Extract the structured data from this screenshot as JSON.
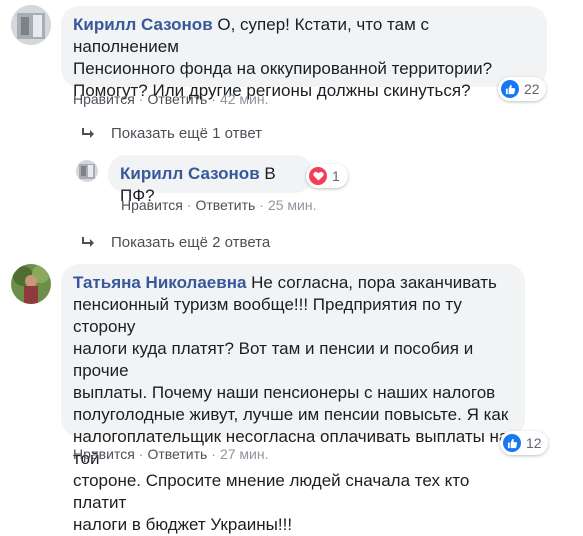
{
  "comments": [
    {
      "author": "Кирилл Сазонов",
      "text_lines": [
        "О, супер! Кстати, что там с наполнением",
        "Пенсионного фонда на оккупированной территории?",
        "Помогут? Или другие регионы должны скинуться?"
      ],
      "like": "Нравится",
      "reply": "Ответить",
      "time": "42 мин.",
      "reaction_icon": "like-icon",
      "reaction_count": "22"
    },
    {
      "author": "Кирилл Сазонов",
      "text": "В ПФ?",
      "like": "Нравится",
      "reply": "Ответить",
      "time": "25 мин.",
      "reaction_icon": "love-icon",
      "reaction_count": "1"
    },
    {
      "author": "Татьяна Николаевна",
      "text_lines": [
        "Не согласна, пора заканчивать",
        "пенсионный туризм вообще!!! Предприятия по ту сторону",
        "налоги куда платят? Вот там и пенсии и пособия и прочие",
        "выплаты. Почему наши пенсионеры с наших налогов",
        "полуголодные живут, лучше им пенсии повысьте. Я как",
        "налогоплательщик несогласна оплачивать выплаты на той",
        "стороне. Спросите мнение людей сначала тех кто платит",
        "налоги в бюджет Украины!!!"
      ],
      "like": "Нравится",
      "reply": "Ответить",
      "time": "27 мин.",
      "reaction_icon": "like-icon",
      "reaction_count": "12"
    }
  ],
  "show_more": [
    {
      "label": "Показать ещё 1 ответ",
      "icon": "reply-arrow-icon"
    },
    {
      "label": "Показать ещё 2 ответа",
      "icon": "reply-arrow-icon"
    }
  ],
  "colors": {
    "author": "#385898",
    "bubble": "#f2f3f5",
    "like_blue": "#1877f2",
    "love_red": "#f33e58"
  }
}
